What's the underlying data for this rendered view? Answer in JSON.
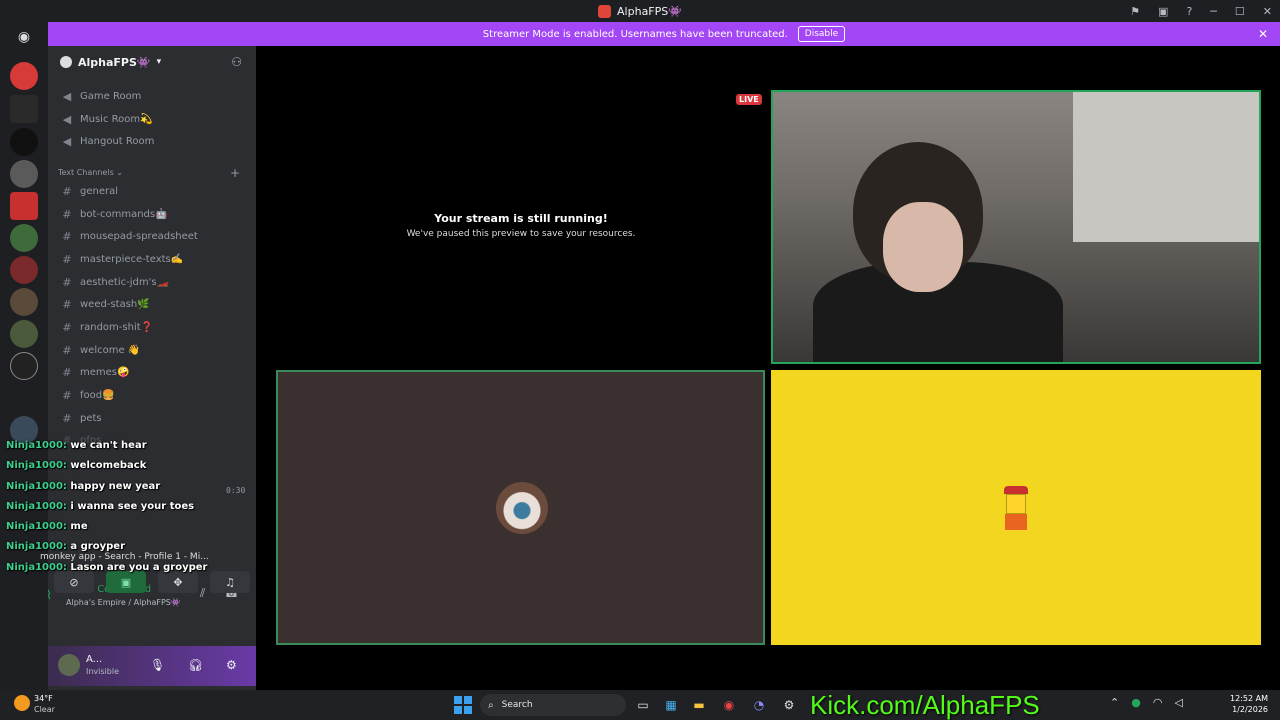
{
  "window": {
    "title": "AlphaFPS👾"
  },
  "banner": {
    "text": "Streamer Mode is enabled. Usernames have been truncated.",
    "disable_label": "Disable"
  },
  "server": {
    "name": "AlphaFPS👾"
  },
  "voice_channels": [
    "Game Room",
    "Music Room💫",
    "Hangout Room"
  ],
  "category": {
    "label": "Text Channels"
  },
  "text_channels": [
    "general",
    "bot-commands🤖",
    "mousepad-spreadsheet",
    "masterpiece-texts✍️",
    "aesthetic-jdm's🏎️",
    "weed-stash🌿",
    "random-shit❓",
    "welcome 👋",
    "memes🤪",
    "food🍔",
    "pets",
    "pfps"
  ],
  "chat": [
    {
      "user": "Ninja1000:",
      "text": "we can't hear"
    },
    {
      "user": "Ninja1000:",
      "text": "welcomeback"
    },
    {
      "user": "Ninja1000:",
      "text": "happy new year"
    },
    {
      "user": "Ninja1000:",
      "text": "i wanna see your toes"
    },
    {
      "user": "Ninja1000:",
      "text": "me"
    },
    {
      "user": "Ninja1000:",
      "text": "a groyper"
    },
    {
      "user": "Ninja1000:",
      "text": "Lason are you a groyper"
    }
  ],
  "activity": {
    "text": "monkey app - Search - Profile 1 - Mi..."
  },
  "timer": "0:30",
  "voice": {
    "status": "Video Connected",
    "location": "Alpha's Empire / AlphaFPS👾"
  },
  "user": {
    "name": "A...",
    "status": "Invisible"
  },
  "stage": {
    "paused_title": "Your stream is still running!",
    "paused_subtitle": "We've paused this preview to save your resources.",
    "live_label": "LIVE"
  },
  "taskbar": {
    "temperature": "34°F",
    "condition": "Clear",
    "search_label": "Search",
    "overlay_text": "Kick.com/AlphaFPS",
    "time": "12:52 AM",
    "date": "1/2/2026"
  },
  "colors": {
    "accent": "#a346f5",
    "connected": "#23a55a",
    "live": "#da373c",
    "kick": "#53fc18"
  }
}
